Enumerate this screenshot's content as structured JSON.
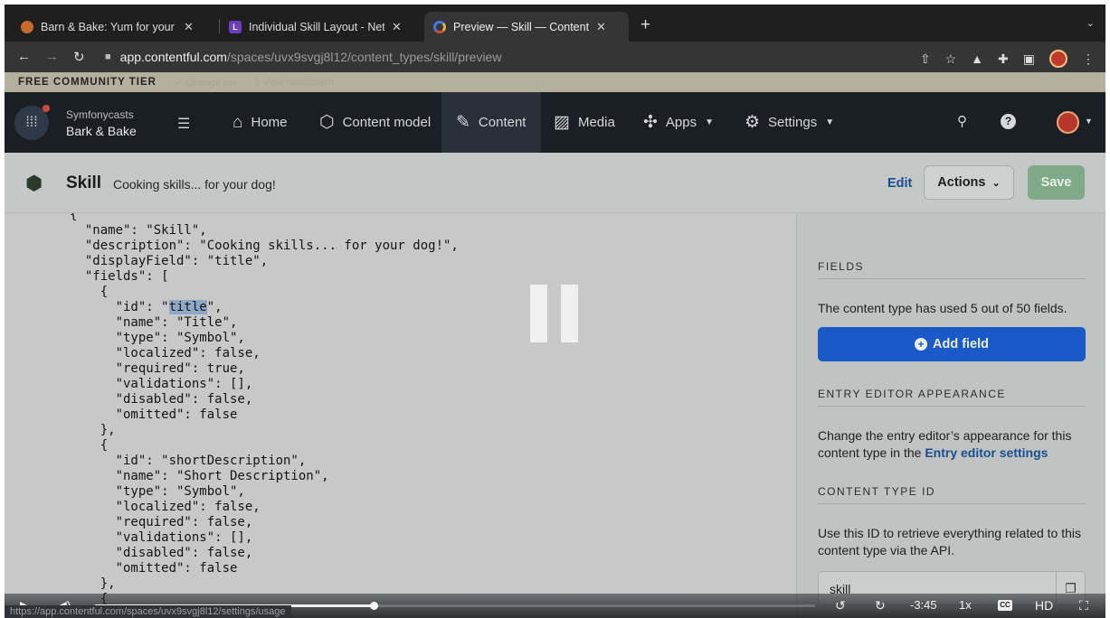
{
  "browser": {
    "tabs": [
      {
        "title": "Barn & Bake: Yum for your Pup",
        "fav_color": "#c86a2a"
      },
      {
        "title": "Individual Skill Layout - Netgen",
        "fav_color": "#6d3fc0",
        "fav_text": "L"
      },
      {
        "title": "Preview — Skill — Content Mod",
        "fav_color": "#3d7be0"
      }
    ],
    "url_host": "app.contentful.com",
    "url_path": "/spaces/uvx9svgj8l12/content_types/skill/preview"
  },
  "banner": {
    "label": "FREE COMMUNITY TIER",
    "faded_1": "✓ Change tier",
    "faded_2": "⫼ View dashboard"
  },
  "navbar": {
    "org": "Symfonycasts",
    "space": "Bark & Bake",
    "items": [
      {
        "label": "Home",
        "icon": "home-icon"
      },
      {
        "label": "Content model",
        "icon": "cube-icon"
      },
      {
        "label": "Content",
        "icon": "edit-icon"
      },
      {
        "label": "Media",
        "icon": "image-icon"
      },
      {
        "label": "Apps",
        "icon": "puzzle-icon"
      },
      {
        "label": "Settings",
        "icon": "gear-icon"
      }
    ]
  },
  "entity": {
    "name": "Skill",
    "description": "Cooking skills... for your dog!",
    "edit_label": "Edit",
    "actions_label": "Actions",
    "save_label": "Save"
  },
  "sidebar": {
    "fields_title": "FIELDS",
    "fields_text": "The content type has used 5 out of 50 fields.",
    "add_field_label": "Add field",
    "appearance_title": "ENTRY EDITOR APPEARANCE",
    "appearance_text": "Change the entry editor’s appearance for this content type in the",
    "appearance_link": "Entry editor settings",
    "ctid_title": "CONTENT TYPE ID",
    "ctid_text": "Use this ID to retrieve everything related to this content type via the API.",
    "ctid_value": "skill"
  },
  "video": {
    "time_remaining": "-3:45",
    "speed": "1x",
    "quality": "HD",
    "cc_label": "CC",
    "progress_fraction": 0.387,
    "status_url": "https://app.contentful.com/spaces/uvx9svgj8l12/settings/usage"
  }
}
